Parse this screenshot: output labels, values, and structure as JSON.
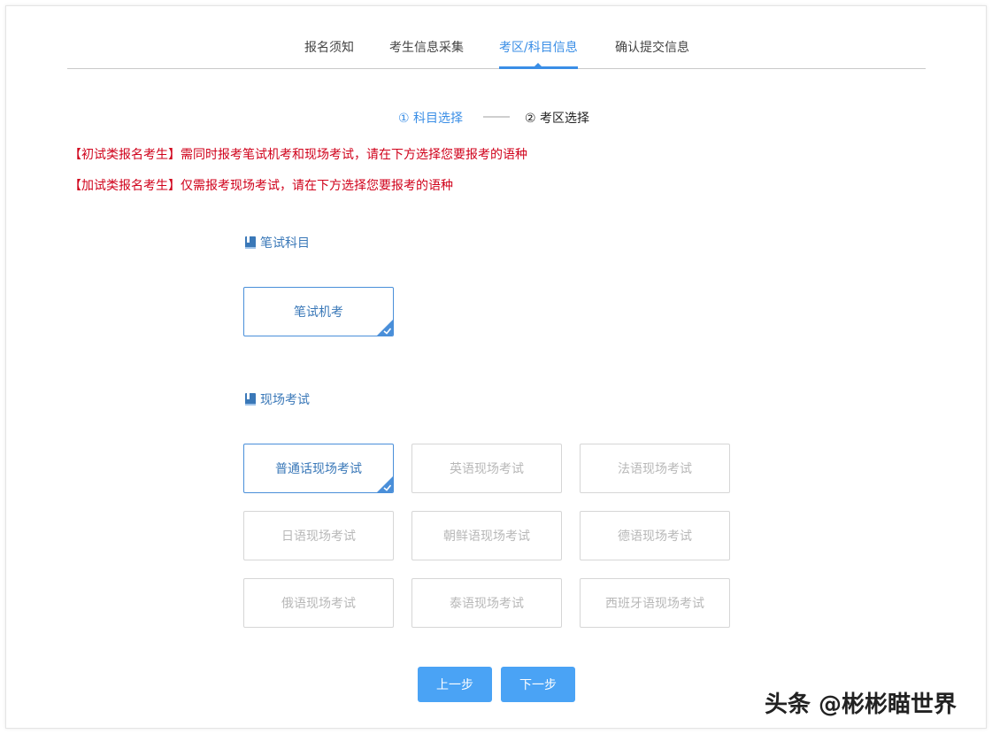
{
  "tabs": [
    {
      "label": "报名须知",
      "active": false
    },
    {
      "label": "考生信息采集",
      "active": false
    },
    {
      "label": "考区/科目信息",
      "active": true
    },
    {
      "label": "确认提交信息",
      "active": false
    }
  ],
  "steps": [
    {
      "label": "① 科目选择",
      "active": true
    },
    {
      "label": "② 考区选择",
      "active": false
    }
  ],
  "notices": [
    "【初试类报名考生】需同时报考笔试机考和现场考试，请在下方选择您要报考的语种",
    "【加试类报名考生】仅需报考现场考试，请在下方选择您要报考的语种"
  ],
  "written_section": {
    "title": "笔试科目",
    "options": [
      {
        "label": "笔试机考",
        "selected": true
      }
    ]
  },
  "onsite_section": {
    "title": "现场考试",
    "options": [
      {
        "label": "普通话现场考试",
        "selected": true
      },
      {
        "label": "英语现场考试",
        "selected": false
      },
      {
        "label": "法语现场考试",
        "selected": false
      },
      {
        "label": "日语现场考试",
        "selected": false
      },
      {
        "label": "朝鲜语现场考试",
        "selected": false
      },
      {
        "label": "德语现场考试",
        "selected": false
      },
      {
        "label": "俄语现场考试",
        "selected": false
      },
      {
        "label": "泰语现场考试",
        "selected": false
      },
      {
        "label": "西班牙语现场考试",
        "selected": false
      }
    ]
  },
  "buttons": {
    "prev_label": "上一步",
    "next_label": "下一步"
  },
  "watermark": "头条 @彬彬瞄世界",
  "colors": {
    "accent": "#3a8ee6",
    "notice": "#d0021b",
    "button": "#4aa3f5"
  }
}
